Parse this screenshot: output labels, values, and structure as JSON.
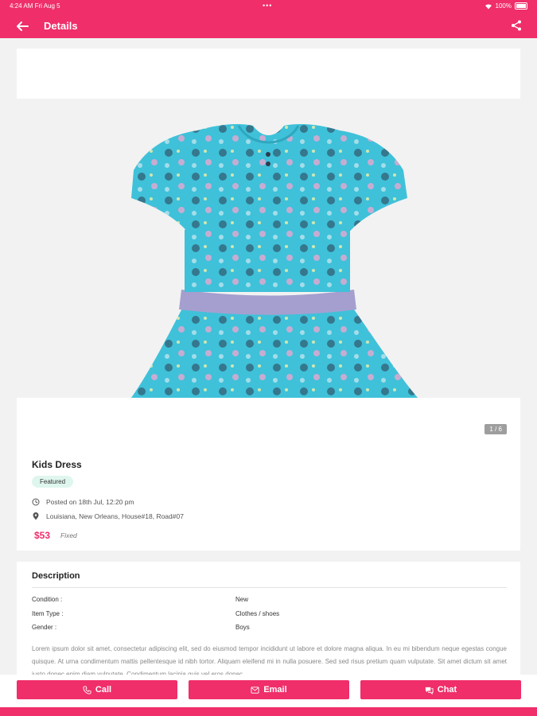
{
  "status": {
    "time": "4:24 AM",
    "date": "Fri Aug 5",
    "dots": "•••",
    "battery": "100%"
  },
  "header": {
    "title": "Details"
  },
  "gallery": {
    "counter": "1 / 6"
  },
  "product": {
    "name": "Kids Dress",
    "badge": "Featured",
    "posted": "Posted on 18th Jul, 12:20 pm",
    "location": "Louisiana, New Orleans, House#18, Road#07",
    "price": "$53",
    "price_type": "Fixed"
  },
  "description": {
    "title": "Description",
    "specs": [
      {
        "label": "Condition :",
        "value": "New"
      },
      {
        "label": "Item Type :",
        "value": "Clothes / shoes"
      },
      {
        "label": "Gender :",
        "value": "Boys"
      }
    ],
    "text": "Lorem ipsum dolor sit amet, consectetur adipiscing elit, sed do eiusmod tempor incididunt ut labore et dolore magna aliqua. In eu mi bibendum neque egestas congue quisque. At urna condimentum mattis pellentesque id nibh tortor. Aliquam eleifend mi in nulla posuere. Sed sed risus pretium quam vulputate. Sit amet dictum sit amet justo donec enim diam vulputate. Condimentum lacinia quis vel eros donec"
  },
  "actions": {
    "call": "Call",
    "email": "Email",
    "chat": "Chat"
  },
  "colors": {
    "accent": "#ef2e6a",
    "dress": "#3fc1d9",
    "belt": "#a59fcf",
    "badge_bg": "#dff6ef"
  }
}
